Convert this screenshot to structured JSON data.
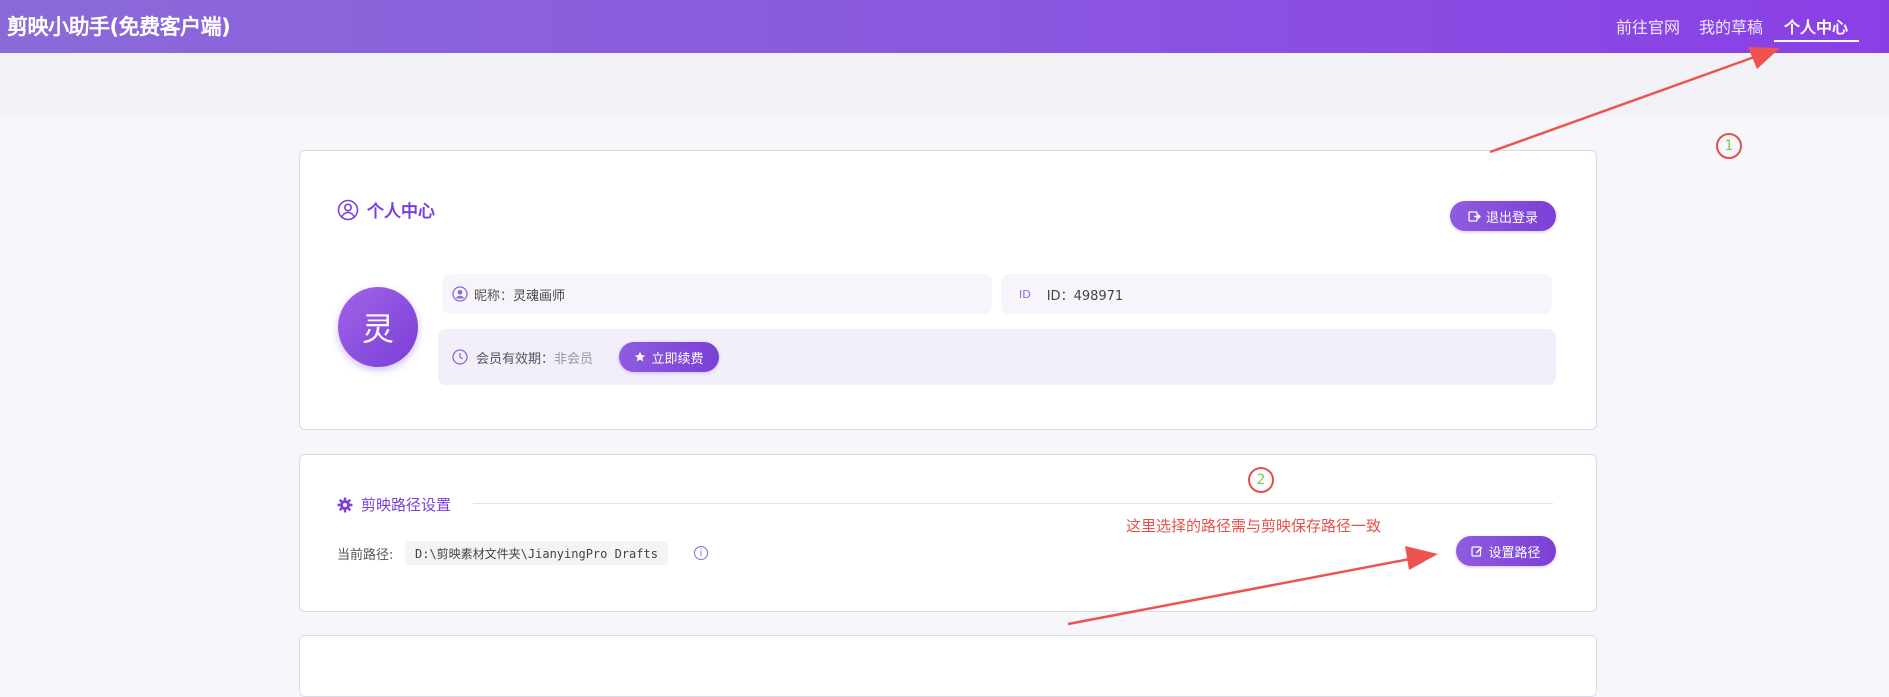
{
  "header": {
    "app_title": "剪映小助手(免费客户端)",
    "nav": [
      {
        "label": "前往官网"
      },
      {
        "label": "我的草稿"
      },
      {
        "label": "个人中心",
        "active": true
      }
    ],
    "gradient_colors": [
      "#8b6ad8",
      "#8a3fe6"
    ]
  },
  "profile": {
    "title": "个人中心",
    "logout_label": "退出登录",
    "avatar_char": "灵",
    "nickname_label": "昵称：",
    "nickname_value": "灵魂画师",
    "id_badge": "ID",
    "id_text": "ID：498971",
    "membership_label": "会员有效期：",
    "membership_value": "非会员",
    "renew_label": "立即续费"
  },
  "path_settings": {
    "title": "剪映路径设置",
    "current_label": "当前路径:",
    "current_value": "D:\\剪映素材文件夹\\JianyingPro Drafts",
    "info_glyph": "i",
    "set_button_label": "设置路径"
  },
  "annotations": {
    "marker_1": "1",
    "marker_2": "2",
    "note": "这里选择的路径需与剪映保存路径一致",
    "color": "#e5504a"
  },
  "colors": {
    "accent": "#7c3fdc",
    "page_bg": "#f7f6fb"
  },
  "icons": [
    "user-circle-icon",
    "logout-icon",
    "clock-icon",
    "star-icon",
    "gear-icon",
    "edit-icon",
    "info-icon"
  ]
}
